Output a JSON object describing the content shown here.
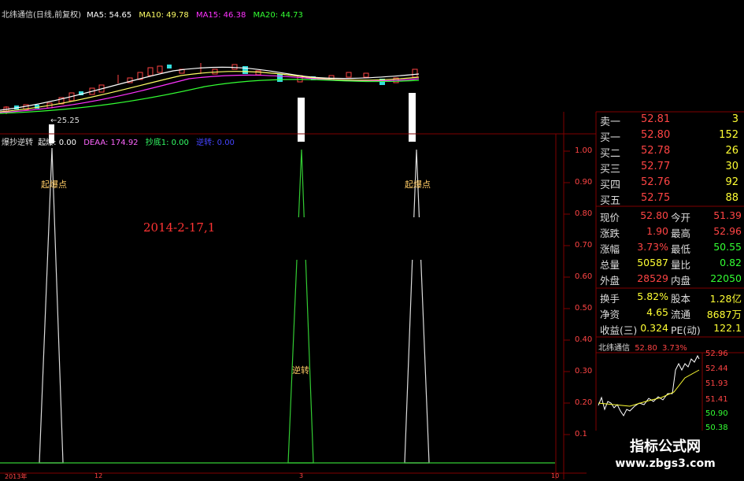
{
  "window": {
    "title": "北纬通信(日线,前复权)"
  },
  "ma": [
    {
      "label": "MA5: 54.65",
      "color": "#ffffff"
    },
    {
      "label": "MA10: 49.78",
      "color": "#ffff66"
    },
    {
      "label": "MA15: 46.38",
      "color": "#ff33ff"
    },
    {
      "label": "MA20: 44.73",
      "color": "#33ff33"
    }
  ],
  "low_marker": "←25.25",
  "indicator": {
    "name": "爆抄逆转",
    "items": [
      {
        "label": "起爆: 0.00",
        "color": "#ffffff"
      },
      {
        "label": "DEAA: 174.92",
        "color": "#ff66ff"
      },
      {
        "label": "抄底1: 0.00",
        "color": "#33ff66"
      },
      {
        "label": "逆转: 0.00",
        "color": "#3333ff"
      }
    ]
  },
  "y_axis_ticks": [
    "1.00",
    "0.90",
    "0.80",
    "0.70",
    "0.60",
    "0.50",
    "0.40",
    "0.30",
    "0.20",
    "0.10"
  ],
  "annotations": [
    {
      "text": "起爆点",
      "color": "#ffcc66"
    },
    {
      "text": "逆转",
      "color": "#ffcc66"
    },
    {
      "text": "起爆点",
      "color": "#ffcc66"
    }
  ],
  "date_label": "2014-2-17,1",
  "x_axis": [
    "2013年",
    "12",
    "3",
    "10"
  ],
  "order_book": [
    {
      "label": "卖一",
      "price": "52.81",
      "vol": "3"
    },
    {
      "label": "买一",
      "price": "52.80",
      "vol": "152"
    },
    {
      "label": "买二",
      "price": "52.78",
      "vol": "26"
    },
    {
      "label": "买三",
      "price": "52.77",
      "vol": "30"
    },
    {
      "label": "买四",
      "price": "52.76",
      "vol": "92"
    },
    {
      "label": "买五",
      "price": "52.75",
      "vol": "88"
    }
  ],
  "stats": [
    {
      "l1": "现价",
      "v1": "52.80",
      "c1": "#ff4444",
      "l2": "今开",
      "v2": "51.39",
      "c2": "#ff4444"
    },
    {
      "l1": "涨跌",
      "v1": "1.90",
      "c1": "#ff4444",
      "l2": "最高",
      "v2": "52.96",
      "c2": "#ff4444"
    },
    {
      "l1": "涨幅",
      "v1": "3.73%",
      "c1": "#ff4444",
      "l2": "最低",
      "v2": "50.55",
      "c2": "#33ff33"
    },
    {
      "l1": "总量",
      "v1": "50587",
      "c1": "#ffff33",
      "l2": "量比",
      "v2": "0.82",
      "c2": "#33ff33"
    },
    {
      "l1": "外盘",
      "v1": "28529",
      "c1": "#ff4444",
      "l2": "内盘",
      "v2": "22050",
      "c2": "#33ff33"
    }
  ],
  "fin": [
    {
      "l1": "换手",
      "v1": "5.82%",
      "l2": "股本",
      "v2": "1.28亿"
    },
    {
      "l1": "净资",
      "v1": "4.65",
      "l2": "流通",
      "v2": "8687万"
    },
    {
      "l1": "收益(三)",
      "v1": "0.324",
      "l2": "PE(动)",
      "v2": "122.1"
    }
  ],
  "mini_chart": {
    "title": "北纬通信",
    "price": "52.80",
    "pct": "3.73%",
    "price_ticks": [
      "52.96",
      "52.44",
      "51.93",
      "51.41",
      "50.90",
      "50.38"
    ]
  },
  "watermark": {
    "line1": "指标公式网",
    "line2": "www.zbgs3.com"
  }
}
